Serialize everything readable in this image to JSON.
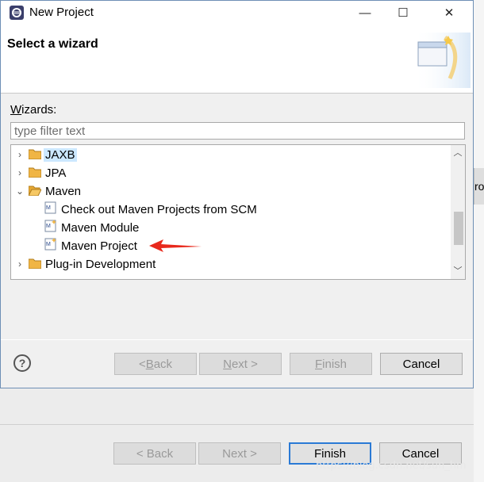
{
  "window": {
    "title": "New Project",
    "minimize_glyph": "—",
    "maximize_glyph": "☐",
    "close_glyph": "✕"
  },
  "header": {
    "heading": "Select a wizard"
  },
  "wizards": {
    "label_first": "W",
    "label_rest": "izards:",
    "filter_placeholder": "type filter text",
    "tree": [
      {
        "label": "JAXB",
        "type": "folder",
        "expanded": false,
        "selected": true
      },
      {
        "label": "JPA",
        "type": "folder",
        "expanded": false
      },
      {
        "label": "Maven",
        "type": "folder",
        "expanded": true
      },
      {
        "label": "Check out Maven Projects from SCM",
        "type": "item"
      },
      {
        "label": "Maven Module",
        "type": "item"
      },
      {
        "label": "Maven Project",
        "type": "item",
        "annotated": true
      },
      {
        "label": "Plug-in Development",
        "type": "folder",
        "expanded": false
      }
    ]
  },
  "footer": {
    "help_glyph": "?",
    "back_pre": "< ",
    "back_ul": "B",
    "back_post": "ack",
    "next_ul": "N",
    "next_post": "ext >",
    "finish_ul": "F",
    "finish_post": "inish",
    "cancel_label": "Cancel"
  },
  "background_footer": {
    "back_label": "< Back",
    "next_label": "Next >",
    "finish_label": "Finish",
    "cancel_label": "Cancel"
  },
  "right_strip_text": "ro",
  "watermark": "https://blog.csdn.net/sun_hm",
  "colors": {
    "selection": "#cce8ff",
    "arrow": "#e8291c",
    "folder": "#f0b545",
    "default_button_border": "#2a7ad5"
  }
}
